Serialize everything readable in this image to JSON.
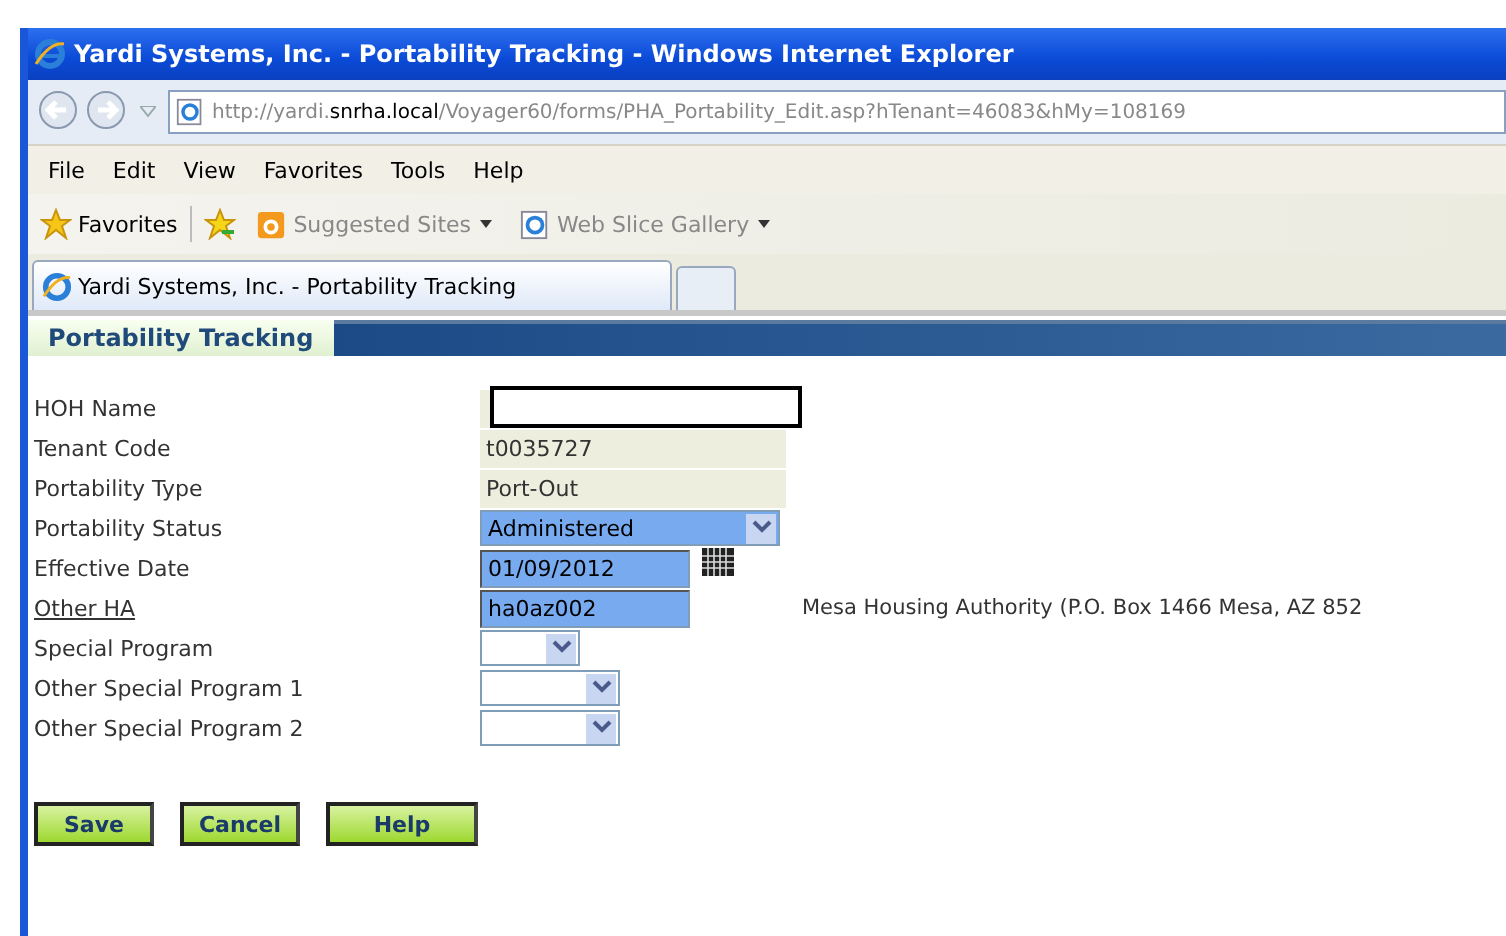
{
  "window": {
    "title": "Yardi Systems, Inc. - Portability Tracking - Windows Internet Explorer"
  },
  "address": {
    "prefix": "http://yardi.",
    "host": "snrha.local",
    "path": "/Voyager60/forms/PHA_Portability_Edit.asp?hTenant=46083&hMy=108169"
  },
  "menu": [
    {
      "label": "File"
    },
    {
      "label": "Edit"
    },
    {
      "label": "View"
    },
    {
      "label": "Favorites"
    },
    {
      "label": "Tools"
    },
    {
      "label": "Help"
    }
  ],
  "favorites_bar": {
    "favorites": "Favorites",
    "links": [
      {
        "label": "Suggested Sites",
        "kind": "sites"
      },
      {
        "label": "Web Slice Gallery",
        "kind": "ie"
      }
    ]
  },
  "tabs": [
    {
      "label": "Yardi Systems, Inc. - Portability Tracking",
      "selected": true
    }
  ],
  "page": {
    "heading": "Portability Tracking",
    "fields": [
      {
        "label": "HOH Name",
        "kind": "readonly",
        "redacted": true
      },
      {
        "label": "Tenant Code",
        "kind": "readonly",
        "value": "t0035727"
      },
      {
        "label": "Portability Type",
        "kind": "readonly",
        "value": "Port-Out"
      },
      {
        "label": "Portability Status",
        "kind": "select",
        "value": "Administered",
        "highlighted": true
      },
      {
        "label": "Effective Date",
        "kind": "date",
        "value": "01/09/2012",
        "highlighted": true
      },
      {
        "label": "Other HA",
        "kind": "text",
        "value": "ha0az002",
        "highlighted": true,
        "link": true,
        "note": "Mesa Housing Authority (P.O. Box 1466  Mesa, AZ 852"
      },
      {
        "label": "Special Program",
        "kind": "select",
        "highlighted": false
      },
      {
        "label": "Other Special Program 1",
        "kind": "select",
        "highlighted": false
      },
      {
        "label": "Other Special Program 2",
        "kind": "select",
        "highlighted": false
      }
    ],
    "buttons": [
      {
        "label": "Save"
      },
      {
        "label": "Cancel"
      },
      {
        "label": "Help"
      }
    ]
  }
}
